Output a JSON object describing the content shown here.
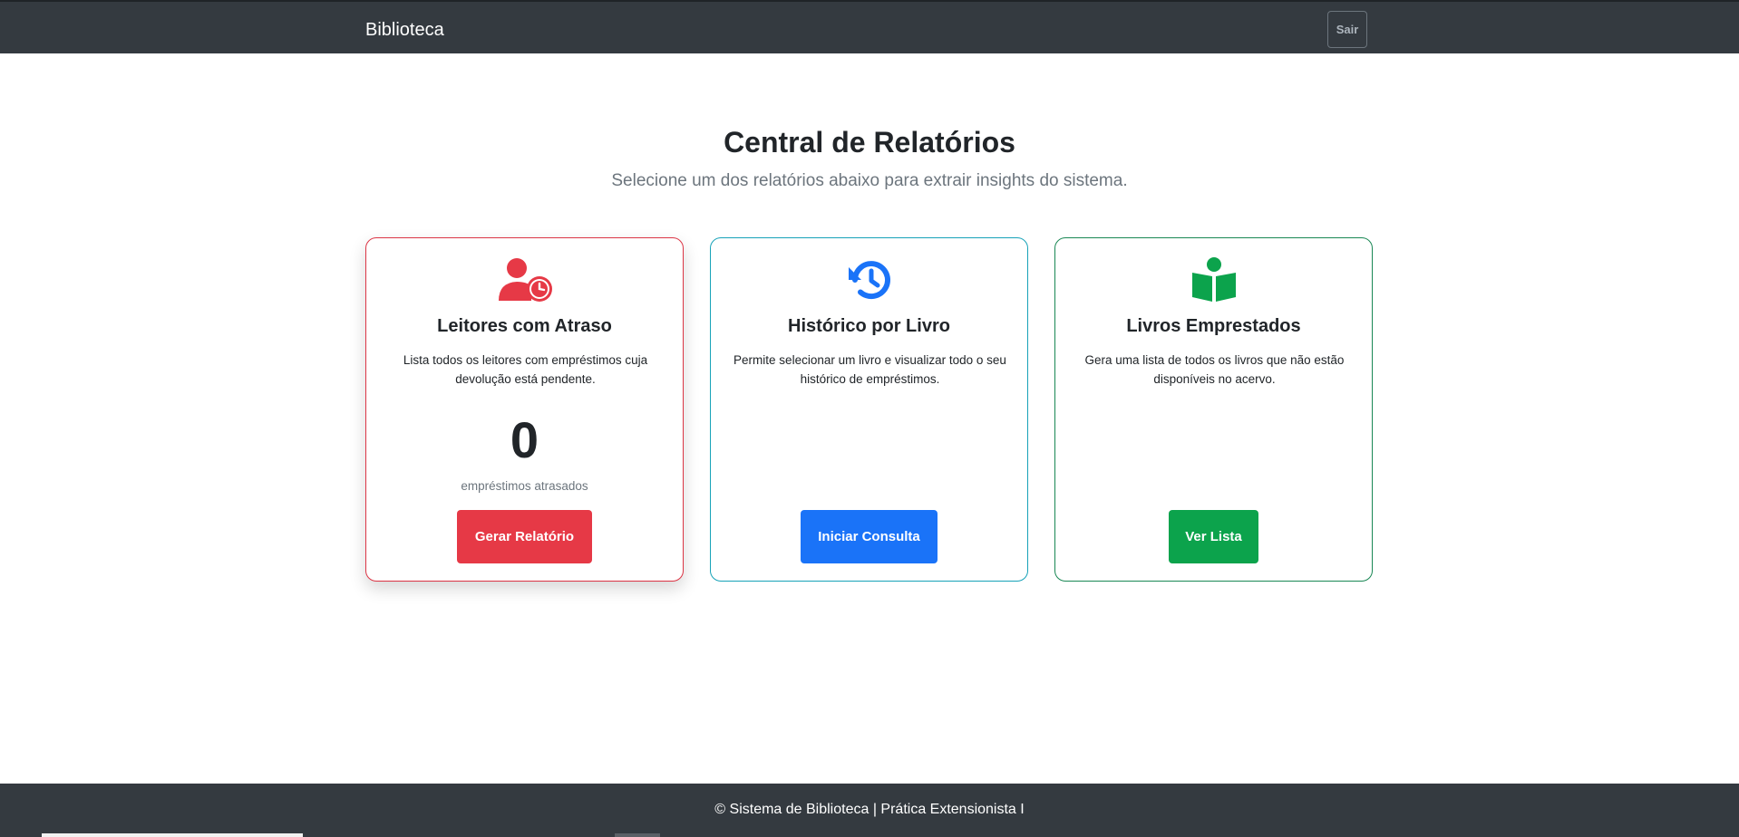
{
  "navbar": {
    "brand": "Biblioteca",
    "logout_label": "Sair"
  },
  "header": {
    "title": "Central de Relatórios",
    "subtitle": "Selecione um dos relatórios abaixo para extrair insights do sistema."
  },
  "cards": [
    {
      "icon": "user-clock-icon",
      "title": "Leitores com Atraso",
      "description": "Lista todos os leitores com empréstimos cuja devolução está pendente.",
      "count": "0",
      "count_label": "empréstimos atrasados",
      "button_label": "Gerar Relatório",
      "color": "#dc3545"
    },
    {
      "icon": "history-icon",
      "title": "Histórico por Livro",
      "description": "Permite selecionar um livro e visualizar todo o seu histórico de empréstimos.",
      "button_label": "Iniciar Consulta",
      "color": "#1a73f8"
    },
    {
      "icon": "book-reader-icon",
      "title": "Livros Emprestados",
      "description": "Gera uma lista de todos os livros que não estão disponíveis no acervo.",
      "button_label": "Ver Lista",
      "color": "#198754"
    }
  ],
  "footer": {
    "text": "© Sistema de Biblioteca | Prática Extensionista I"
  }
}
